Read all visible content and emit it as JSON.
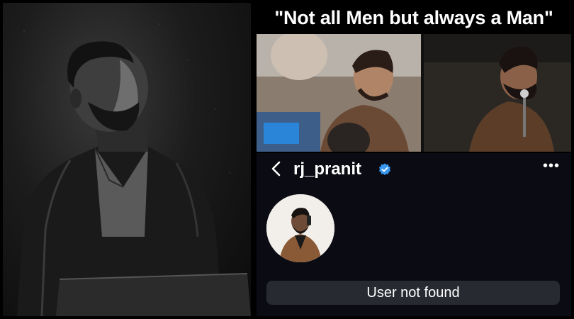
{
  "meme": {
    "caption": "\"Not all Men but always a Man\""
  },
  "profile": {
    "username": "rj_pranit",
    "verified": true,
    "back_icon": "chevron-left-icon",
    "more_icon": "more-horizontal-icon",
    "more_label": "•••",
    "status_text": "User not found"
  },
  "colors": {
    "screen_bg": "#0b0c13",
    "verified_blue": "#3897f0",
    "status_bg": "#272a31"
  }
}
